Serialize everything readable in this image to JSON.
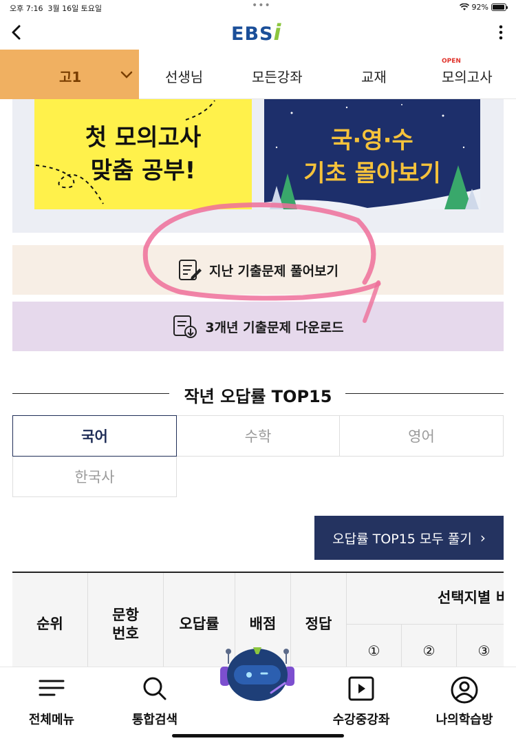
{
  "status": {
    "time": "오후 7:16",
    "date": "3월 16일 토요일",
    "battery": "92%",
    "battery_level": 0.92
  },
  "topbar": {
    "logo_main": "EBS",
    "logo_accent": "i"
  },
  "nav": {
    "grade": "고1",
    "items": [
      "선생님",
      "모든강좌",
      "교재",
      "모의고사"
    ],
    "open_tag": "OPEN"
  },
  "banners": {
    "yellow": {
      "line1": "첫 모의고사",
      "line2": "맞춤 공부!"
    },
    "navy": {
      "line1": "국·영·수",
      "line2": "기초 몰아보기"
    }
  },
  "actions": {
    "past_exams": "지난 기출문제 풀어보기",
    "download": "3개년 기출문제 다운로드"
  },
  "section": {
    "title": "작년 오답률 TOP15"
  },
  "subjects": {
    "tabs": [
      "국어",
      "수학",
      "영어",
      "한국사"
    ],
    "active": "국어"
  },
  "solve_all": {
    "label": "오답률 TOP15 모두 풀기",
    "arrow": "›"
  },
  "table": {
    "headers": [
      "순위",
      "문항\n번호",
      "오답률",
      "배점",
      "정답"
    ],
    "choice_group": "선택지별 비",
    "choices": [
      "①",
      "②",
      "③"
    ]
  },
  "tabbar": {
    "items": [
      "전체메뉴",
      "통합검색",
      "수강중강좌",
      "나의학습방"
    ]
  },
  "colors": {
    "grade_bg": "#f0b061",
    "navy": "#243360",
    "logo_blue": "#1b4f99",
    "logo_green": "#8cc63f",
    "annotation_pink": "#ee6f9a"
  }
}
